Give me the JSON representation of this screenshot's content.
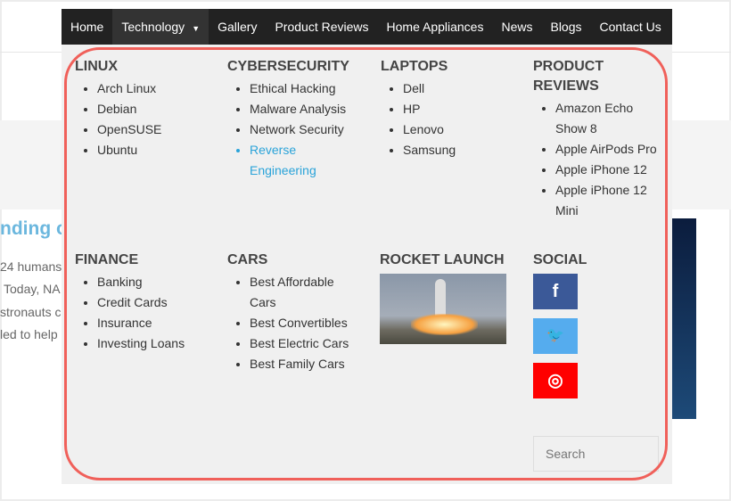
{
  "nav": [
    "Home",
    "Technology",
    "Gallery",
    "Product Reviews",
    "Home Appliances",
    "News",
    "Blogs",
    "Contact Us"
  ],
  "background": {
    "title": "nding o",
    "lines": [
      "24 humans",
      "Today, NA",
      "stronauts c",
      "led to help"
    ]
  },
  "columns": [
    {
      "heading": "LINUX",
      "items": [
        "Arch Linux",
        "Debian",
        "OpenSUSE",
        "Ubuntu"
      ]
    },
    {
      "heading": "CYBERSECURITY",
      "items": [
        "Ethical Hacking",
        "Malware Analysis",
        "Network Security",
        "Reverse Engineering"
      ]
    },
    {
      "heading": "LAPTOPS",
      "items": [
        "Dell",
        "HP",
        "Lenovo",
        "Samsung"
      ]
    },
    {
      "heading": "PRODUCT REVIEWS",
      "items": [
        "Amazon Echo Show 8",
        "Apple AirPods Pro",
        "Apple iPhone 12",
        "Apple iPhone 12 Mini"
      ]
    },
    {
      "heading": "FINANCE",
      "items": [
        "Banking",
        "Credit Cards",
        "Insurance",
        "Investing Loans"
      ]
    },
    {
      "heading": "CARS",
      "items": [
        "Best Affordable Cars",
        "Best Convertibles",
        "Best Electric Cars",
        "Best Family Cars"
      ]
    },
    {
      "heading": "ROCKET LAUNCH"
    },
    {
      "heading": "SOCIAL"
    }
  ],
  "social": [
    {
      "icon": "facebook-icon",
      "glyph": "f",
      "color": "#3b5998"
    },
    {
      "icon": "twitter-icon",
      "glyph": "🐦",
      "color": "#55acee"
    },
    {
      "icon": "instagram-icon",
      "glyph": "◎",
      "color": "#ff0000"
    }
  ],
  "search": {
    "placeholder": "Search"
  },
  "colors": {
    "highlight": "#f0605a",
    "link": "#2aa3d9"
  }
}
